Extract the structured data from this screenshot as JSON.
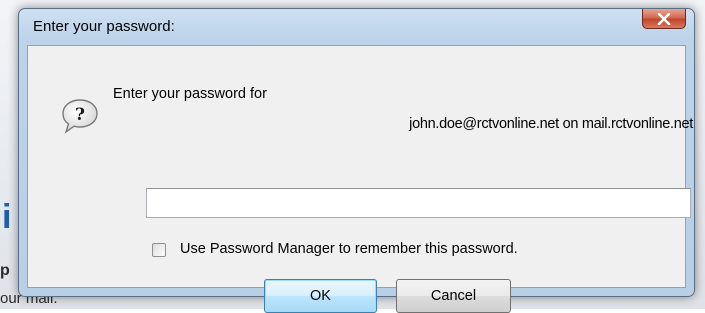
{
  "dialog": {
    "title": "Enter your password:",
    "prompt_line1": "Enter your password for",
    "prompt_line2": "john.doe@rctvonline.net on mail.rctvonline.net",
    "password_value": "",
    "checkbox_label": "Use Password Manager to remember this password.",
    "checkbox_checked": false,
    "ok_label": "OK",
    "cancel_label": "Cancel",
    "close_icon": "close-icon",
    "prompt_icon": "question-icon"
  },
  "background": {
    "fragment_i": "i",
    "fragment_p": "p",
    "fragment_line": "our mail."
  },
  "colors": {
    "titlebar": "#bcd3ea",
    "close_button": "#c0452c",
    "default_button_border": "#3c7fb1"
  }
}
